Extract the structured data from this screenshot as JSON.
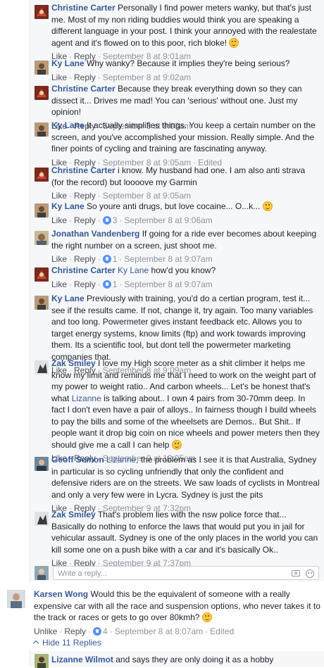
{
  "replies": [
    {
      "name": "Christine Carter",
      "text": "Personally I find power meters wanky, but that's just me. Most of my non riding buddies would think you are speaking a different language in your post. I think your annoyed with the realestate agent and it's flowed on to this poor, rich bloke!",
      "emoji": true,
      "time": "September 8 at 9:01am",
      "likes": "",
      "edited": ""
    },
    {
      "name": "Ky Lane",
      "text": "Why wanky? Because it implies they're being serious?",
      "time": "September 8 at 9:02am",
      "likes": "",
      "edited": ""
    },
    {
      "name": "Christine Carter",
      "text": "Because they break everything down so they can dissect it... Drives me mad! You can 'serious' without one. Just my opinion!",
      "time": "September 8 at 9:03am",
      "likes": "",
      "edited": ""
    },
    {
      "name": "Ky Lane",
      "text": "It actually simplifies things. You keep a certain number on the screen, and you've accomplished your mission. Really simple. And the finer points of cycling and training are fascinating anyway.",
      "time": "September 8 at 9:05am",
      "likes": "",
      "edited": "Edited"
    },
    {
      "name": "Christine Carter",
      "text": "i know. My husband had one. I am also anti strava (for the record) but loooove my Garmin",
      "time": "September 8 at 9:05am",
      "likes": "",
      "edited": ""
    },
    {
      "name": "Ky Lane",
      "text": "So youre anti drugs, but love cocaine... O...k...",
      "emoji": true,
      "time": "September 8 at 9:06am",
      "likes": "3",
      "edited": ""
    },
    {
      "name": "Jonathan Vandenberg",
      "text": "If going for a ride ever becomes about keeping the right number on a screen, just shoot me.",
      "time": "September 8 at 9:07am",
      "likes": "1",
      "edited": ""
    },
    {
      "name": "Christine Carter",
      "mention": "Ky Lane",
      "text": "how'd you know?",
      "time": "September 8 at 9:07am",
      "likes": "1",
      "edited": ""
    },
    {
      "name": "Ky Lane",
      "text": "Previously with training, you'd do a certian program, test it... see if the results came. If not, change it, try again. Too many variables and too long. Powermeter gives instant feedback etc. Allows you to target energy systems, know limits (ftp) and work towards improving them. Its a scientific tool, but dont tell the powermeter marketing companies that.",
      "time": "September 8 at 9:09am",
      "likes": "",
      "edited": ""
    },
    {
      "name": "Zak Smiley",
      "text_a": "I love my High score meter as a shit climber it helps me know my limit and reminds me that I need to work on the weight part of my power to weight ratio.. And carbon wheels... Let's be honest that's what",
      "mention": "Lizanne",
      "text": "is talking about.. I own 4 pairs from 30-70mm deep. In fact I don't even have a pair of alloys.. In fairness though I build wheels to pay the bills and some of the wheelsets are Demos.. But Shit.. If people want it drop big coin on nice wheels and power meters then they should give me a call I can help",
      "emoji": true,
      "time": "September 9 at 12:05am",
      "likes": "",
      "edited": ""
    },
    {
      "name": "Geoff Semon",
      "mention": "Lizanne",
      "text": ", the problem as I see it is that Australia, Sydney in particular is so cycling unfriendly that only the confident and defensive riders are on the streets. We saw loads of cyclists in Montreal and only a very few were in Lycra. Sydney is just the pits",
      "time": "September 9 at 7:32pm",
      "likes": "",
      "edited": ""
    },
    {
      "name": "Zak Smiley",
      "text": "That's problem lies with the nsw police force that... Basically do nothing to enforce the laws that would put you in jail for vehicular assault. Sydney is one of the only places in the world you can kill some one on a push bike with a car and it's basically Ok..",
      "time": "September 9 at 7:37pm",
      "likes": "",
      "edited": ""
    }
  ],
  "actions": {
    "like": "Like",
    "reply": "Reply",
    "unlike": "Unlike",
    "dot": "·"
  },
  "write_reply": {
    "placeholder": "Write a reply..."
  },
  "main_comment": {
    "name": "Karsen Wong",
    "text": "Would this be the equivalent of someone with a really expensive car with all the race and suspension options, who never takes it to the track or races or gets to go over 80kmh?",
    "time": "September 8 at 8:07am",
    "likes": "4",
    "edited": "Edited"
  },
  "hide_replies": "Hide 11 Replies",
  "bottom_reply": {
    "name": "Lizanne Wilmot",
    "text": "and says they are only doing it as a hobby"
  },
  "colors": {
    "link": "#365899",
    "meta": "#90949c",
    "thread_bg": "#f6f7f9",
    "like_blue": "#5890ff"
  }
}
